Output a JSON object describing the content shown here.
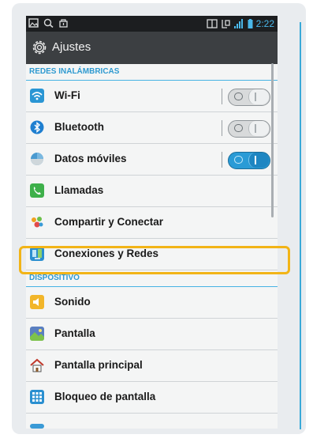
{
  "status": {
    "time": "2:22"
  },
  "actionbar": {
    "title": "Ajustes",
    "icon": "gear-icon"
  },
  "sections": [
    {
      "title": "REDES INALÁMBRICAS"
    },
    {
      "title": "DISPOSITIVO"
    }
  ],
  "items": [
    {
      "label": "Wi-Fi",
      "icon": "wifi-icon",
      "toggle": "off"
    },
    {
      "label": "Bluetooth",
      "icon": "bluetooth-icon",
      "toggle": "off"
    },
    {
      "label": "Datos móviles",
      "icon": "mobile-data-icon",
      "toggle": "on"
    },
    {
      "label": "Llamadas",
      "icon": "phone-icon"
    },
    {
      "label": "Compartir y Conectar",
      "icon": "share-connect-icon"
    },
    {
      "label": "Conexiones y Redes",
      "icon": "networks-icon",
      "highlighted": true
    },
    {
      "label": "Sonido",
      "icon": "sound-icon"
    },
    {
      "label": "Pantalla",
      "icon": "display-icon"
    },
    {
      "label": "Pantalla principal",
      "icon": "home-icon"
    },
    {
      "label": "Bloqueo de pantalla",
      "icon": "lock-screen-icon"
    }
  ],
  "colors": {
    "accent": "#2f9ad0",
    "highlight": "#f2b417",
    "actionbar": "#3c3f42"
  }
}
